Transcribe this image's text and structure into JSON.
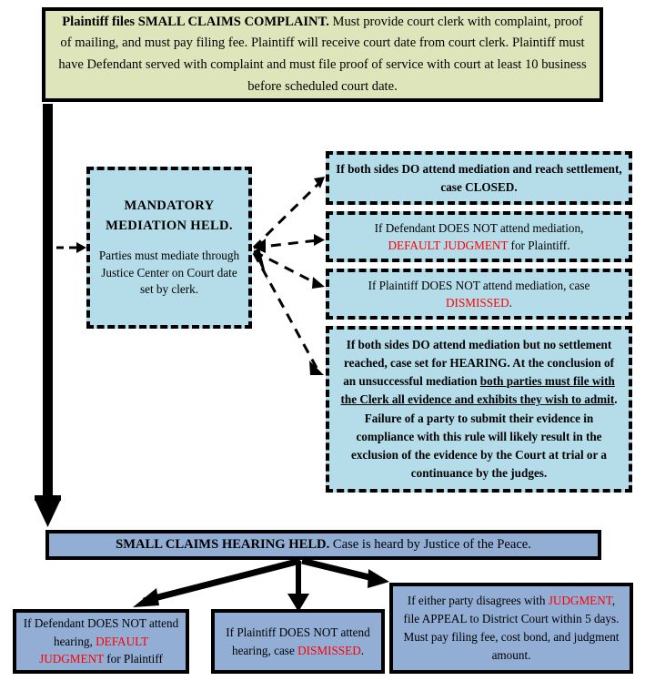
{
  "document": {
    "title": "Small Claims Court Process Flowchart"
  },
  "colors": {
    "complaint_fill": "#dfe5bb",
    "mediation_fill": "#b4dce9",
    "hearing_fill": "#92aed5",
    "border": "#000000",
    "highlight_text": "#ff0000"
  },
  "nodes": {
    "complaint": {
      "id": "plaintiff-files-complaint",
      "shape": "solid-rect",
      "fill": "#dfe5bb",
      "text_bold_lead": "Plaintiff files SMALL CLAIMS COMPLAINT.",
      "text_rest": "  Must provide court clerk with complaint, proof of mailing, and must pay filing fee.  Plaintiff will receive court date from court clerk.  Plaintiff must have Defendant served with complaint and must file proof of service with court at least 10 business before scheduled court date."
    },
    "mediation": {
      "id": "mandatory-mediation-held",
      "shape": "dashed-rect",
      "fill": "#b4dce9",
      "heading": "MANDATORY MEDIATION HELD.",
      "body": "Parties must mediate through Justice Center on Court date set by clerk."
    },
    "outcome_settled": {
      "id": "both-attend-settlement-closed",
      "shape": "dashed-rect",
      "fill": "#b4dce9",
      "text": "If both sides DO attend mediation and reach settlement, case CLOSED."
    },
    "outcome_defendant_absent": {
      "id": "defendant-not-attend-mediation",
      "shape": "dashed-rect",
      "fill": "#b4dce9",
      "line1": "If Defendant DOES NOT attend mediation,",
      "highlight": "DEFAULT JUDGMENT",
      "line2_rest": " for Plaintiff."
    },
    "outcome_plaintiff_absent": {
      "id": "plaintiff-not-attend-mediation",
      "shape": "dashed-rect",
      "fill": "#b4dce9",
      "line1": "If Plaintiff DOES NOT attend mediation, case",
      "highlight": "DISMISSED",
      "line2_rest": "."
    },
    "outcome_no_settlement": {
      "id": "both-attend-no-settlement-hearing",
      "shape": "dashed-rect",
      "fill": "#b4dce9",
      "part1": "If both sides DO attend mediation but no settlement reached, case set for HEARING. At the conclusion of an unsuccessful mediation ",
      "underlined": "both parties must file with the Clerk all evidence and exhibits they wish to admit",
      "part2": ". Failure of a party to submit their evidence in compliance with this rule will likely result in the exclusion of the evidence by the Court at trial or a continuance by the judges."
    },
    "hearing_held": {
      "id": "small-claims-hearing-held",
      "shape": "solid-rect",
      "fill": "#92aed5",
      "text_bold_lead": "SMALL CLAIMS HEARING HELD.",
      "text_rest": "  Case is heard by Justice of the Peace."
    },
    "bottom_defendant_absent": {
      "id": "defendant-not-attend-hearing",
      "shape": "solid-rect",
      "fill": "#92aed5",
      "line1": "If Defendant DOES NOT attend hearing, ",
      "highlight": "DEFAULT JUDGMENT",
      "line2_rest": " for Plaintiff"
    },
    "bottom_plaintiff_absent": {
      "id": "plaintiff-not-attend-hearing",
      "shape": "solid-rect",
      "fill": "#92aed5",
      "line1": "If Plaintiff DOES NOT attend hearing, case ",
      "highlight": "DISMISSED",
      "line2_rest": "."
    },
    "bottom_appeal": {
      "id": "appeal-to-district-court",
      "shape": "solid-rect",
      "fill": "#92aed5",
      "line1": "If either party disagrees with ",
      "highlight": "JUDGMENT",
      "line2_rest": ", file APPEAL to District Court within 5 days.  Must pay filing fee, cost bond, and judgment amount."
    }
  },
  "connectors": [
    {
      "id": "complaint-to-hearing",
      "style": "solid-thick",
      "from": "complaint",
      "to": "hearing_held"
    },
    {
      "id": "trunk-to-mediation",
      "style": "dashed-thin",
      "from": "complaint",
      "to": "mediation"
    },
    {
      "id": "mediation-to-settled",
      "style": "dashed-thin",
      "from": "mediation",
      "to": "outcome_settled"
    },
    {
      "id": "mediation-to-defendant-absent",
      "style": "dashed-thin",
      "from": "mediation",
      "to": "outcome_defendant_absent"
    },
    {
      "id": "mediation-to-plaintiff-absent",
      "style": "dashed-thin",
      "from": "mediation",
      "to": "outcome_plaintiff_absent"
    },
    {
      "id": "mediation-to-no-settlement",
      "style": "dashed-thin",
      "from": "mediation",
      "to": "outcome_no_settlement"
    },
    {
      "id": "hearing-to-defendant-absent",
      "style": "solid-thick",
      "from": "hearing_held",
      "to": "bottom_defendant_absent"
    },
    {
      "id": "hearing-to-plaintiff-absent",
      "style": "solid-thick",
      "from": "hearing_held",
      "to": "bottom_plaintiff_absent"
    },
    {
      "id": "hearing-to-appeal",
      "style": "solid-thick",
      "from": "hearing_held",
      "to": "bottom_appeal"
    }
  ]
}
